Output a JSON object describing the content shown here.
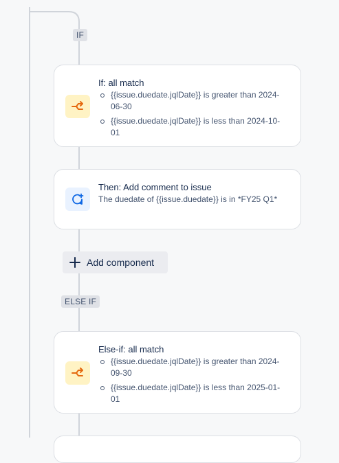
{
  "badges": {
    "if": "IF",
    "else_if": "ELSE IF"
  },
  "if_card": {
    "title": "If: all match",
    "conditions": [
      "{{issue.duedate.jqlDate}} is greater than 2024-06-30",
      "{{issue.duedate.jqlDate}} is less than 2024-10-01"
    ],
    "icon": "branch-icon"
  },
  "then_card": {
    "title": "Then: Add comment to issue",
    "description": "The duedate of {{issue.duedate}} is in *FY25 Q1*",
    "icon": "add-comment-icon"
  },
  "add_component": {
    "label": "Add component",
    "icon": "plus-icon"
  },
  "else_if_card": {
    "title": "Else-if: all match",
    "conditions": [
      "{{issue.duedate.jqlDate}} is greater than 2024-09-30",
      "{{issue.duedate.jqlDate}} is less than 2025-01-01"
    ],
    "icon": "branch-icon"
  },
  "colors": {
    "condition_icon": "#e56910",
    "action_icon": "#0c66e4",
    "connector": "#d0d4da"
  }
}
